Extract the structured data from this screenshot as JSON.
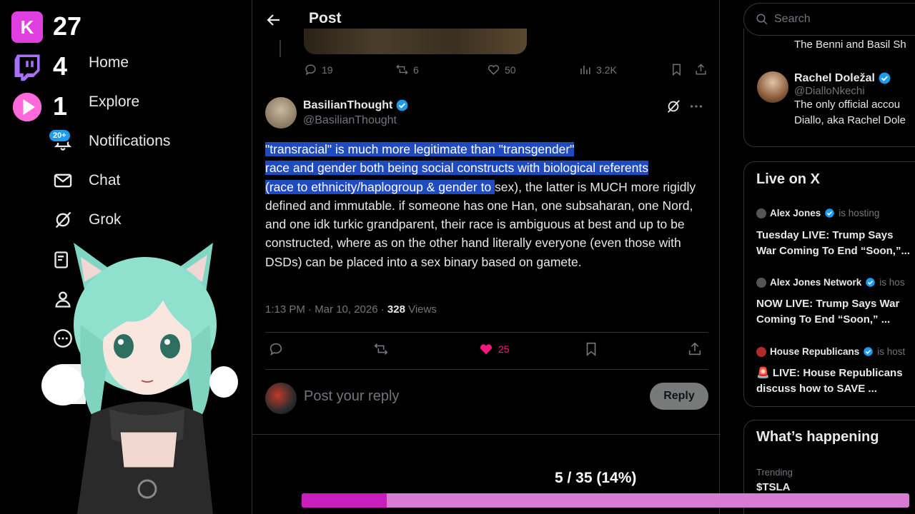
{
  "overlay": {
    "counters": [
      {
        "platform": "kick",
        "count": "27"
      },
      {
        "platform": "twitch",
        "count": "4"
      },
      {
        "platform": "youtube",
        "count": "1"
      }
    ],
    "progress": {
      "text": "5 / 35 (14%)",
      "fraction": 0.14
    },
    "colors": {
      "kick": "#df3fe0",
      "twitch": "#a970ff",
      "youtube": "#ff69d9",
      "progress_fill": "#c61fbe",
      "progress_track": "#d77bd4"
    }
  },
  "nav": {
    "items": [
      {
        "label": "Home",
        "icon": "home-icon"
      },
      {
        "label": "Explore",
        "icon": "search-icon"
      },
      {
        "label": "Notifications",
        "icon": "bell-icon",
        "badge": "20+"
      },
      {
        "label": "Chat",
        "icon": "mail-icon"
      },
      {
        "label": "Grok",
        "icon": "grok-icon"
      }
    ]
  },
  "header": {
    "title": "Post"
  },
  "prev_post_actions": {
    "replies": "19",
    "reposts": "6",
    "likes": "50",
    "views": "3.2K"
  },
  "post": {
    "author_name": "BasilianThought",
    "author_handle": "@BasilianThought",
    "text_highlighted_1": "\"transracial\" is much more legitimate than \"transgender\"",
    "text_highlighted_2": "race and gender both being social constructs with biological referents",
    "text_highlighted_3": "(race to ethnicity/haplogroup & gender to ",
    "text_rest": "sex), the latter is MUCH more rigidly defined and immutable. if someone has one Han, one subsaharan, one Nord, and one idk turkic grandparent, their race is ambiguous at best and up to be constructed, where as on the other hand literally everyone (even those with DSDs) can be placed into a sex binary based on gamete.",
    "timestamp": "1:13 PM · Mar 10, 2026 · ",
    "views_count": "328",
    "views_label": " Views",
    "likes": "25"
  },
  "reply": {
    "placeholder": "Post your reply",
    "button": "Reply"
  },
  "right": {
    "search_placeholder": "Search",
    "account_top_bio": "The Benni and Basil Sh",
    "account": {
      "name": "Rachel Doležal",
      "handle": "@DialloNkechi",
      "bio_1": "The only official accou",
      "bio_2": "Diallo, aka Rachel Dole"
    },
    "live": {
      "title": "Live on X",
      "items": [
        {
          "host": "Alex Jones",
          "suffix": "is hosting",
          "line1": "Tuesday LIVE: Trump Says",
          "line2": "War Coming To End “Soon,”..."
        },
        {
          "host": "Alex Jones Network",
          "suffix": "is hos",
          "line1": "NOW LIVE: Trump Says War",
          "line2": "Coming To End “Soon,” ..."
        },
        {
          "host": "House Republicans",
          "suffix": "is host",
          "line1": "🚨 LIVE: House Republicans",
          "line2": "discuss how to SAVE ..."
        }
      ]
    },
    "happening": {
      "title": "What’s happening",
      "trend_label": "Trending",
      "trend_name": "$TSLA"
    }
  }
}
